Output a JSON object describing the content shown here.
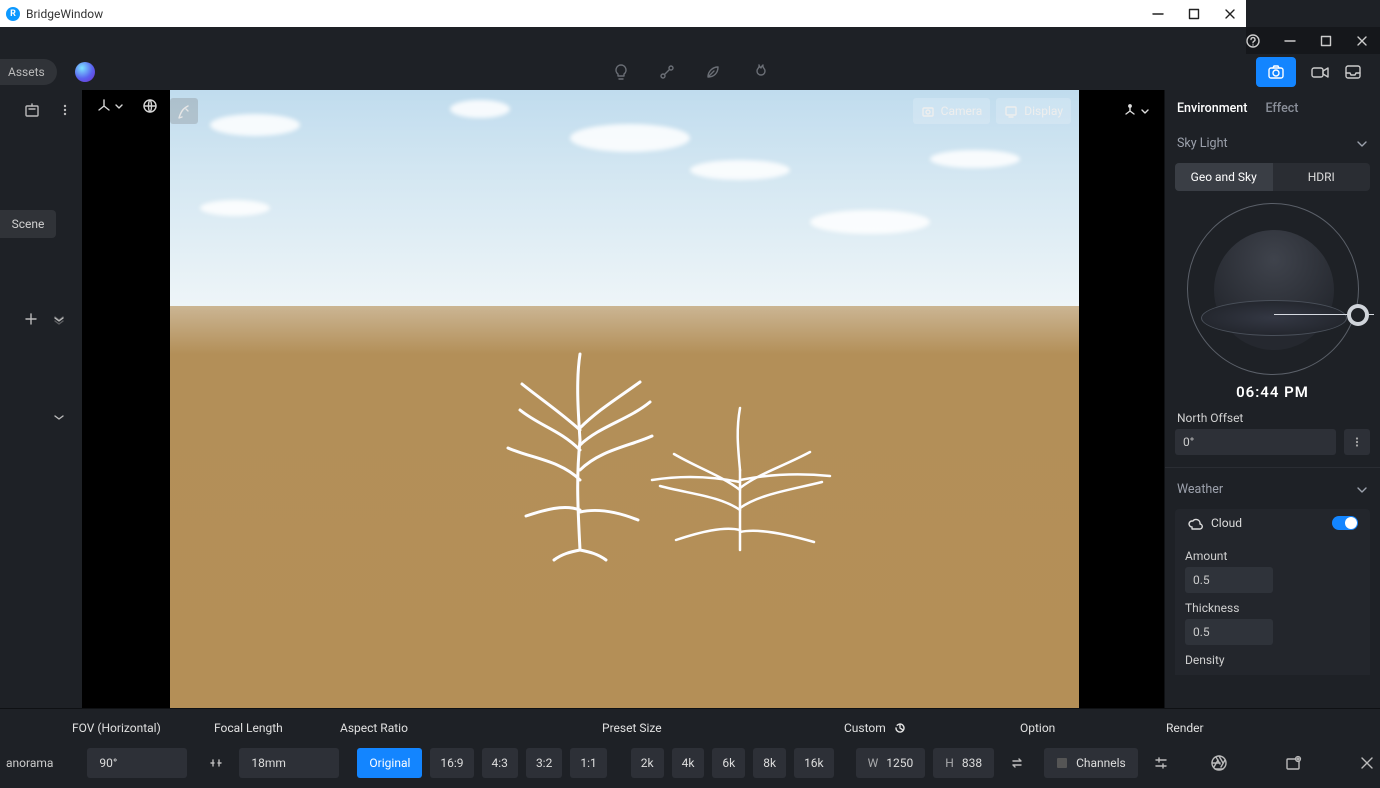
{
  "bridge": {
    "title": "BridgeWindow"
  },
  "leftToolbar": {
    "assets": "Assets"
  },
  "leftRail": {
    "scene": "Scene"
  },
  "viewportPills": {
    "camera": "Camera",
    "display": "Display"
  },
  "rightPanel": {
    "tabs": {
      "environment": "Environment",
      "effect": "Effect"
    },
    "skyLight": {
      "title": "Sky Light",
      "geoSky": "Geo and Sky",
      "hdri": "HDRI"
    },
    "time": "06:44 PM",
    "northOffset": {
      "label": "North Offset",
      "value": "0°"
    },
    "weather": {
      "title": "Weather",
      "cloud": "Cloud",
      "amountLabel": "Amount",
      "amountValue": "0.5",
      "thicknessLabel": "Thickness",
      "thicknessValue": "0.5",
      "densityLabel": "Density"
    }
  },
  "bottom": {
    "panorama": "anorama",
    "fovLabel": "FOV (Horizontal)",
    "fovValue": "90°",
    "focalLabel": "Focal Length",
    "focalValue": "18mm",
    "aspectLabel": "Aspect Ratio",
    "ratios": {
      "original": "Original",
      "r169": "16:9",
      "r43": "4:3",
      "r32": "3:2",
      "r11": "1:1"
    },
    "presetLabel": "Preset Size",
    "presets": {
      "p2k": "2k",
      "p4k": "4k",
      "p6k": "6k",
      "p8k": "8k",
      "p16k": "16k"
    },
    "customLabel": "Custom",
    "wLabel": "W",
    "wVal": "1250",
    "hLabel": "H",
    "hVal": "838",
    "optionLabel": "Option",
    "channels": "Channels",
    "renderLabel": "Render"
  }
}
